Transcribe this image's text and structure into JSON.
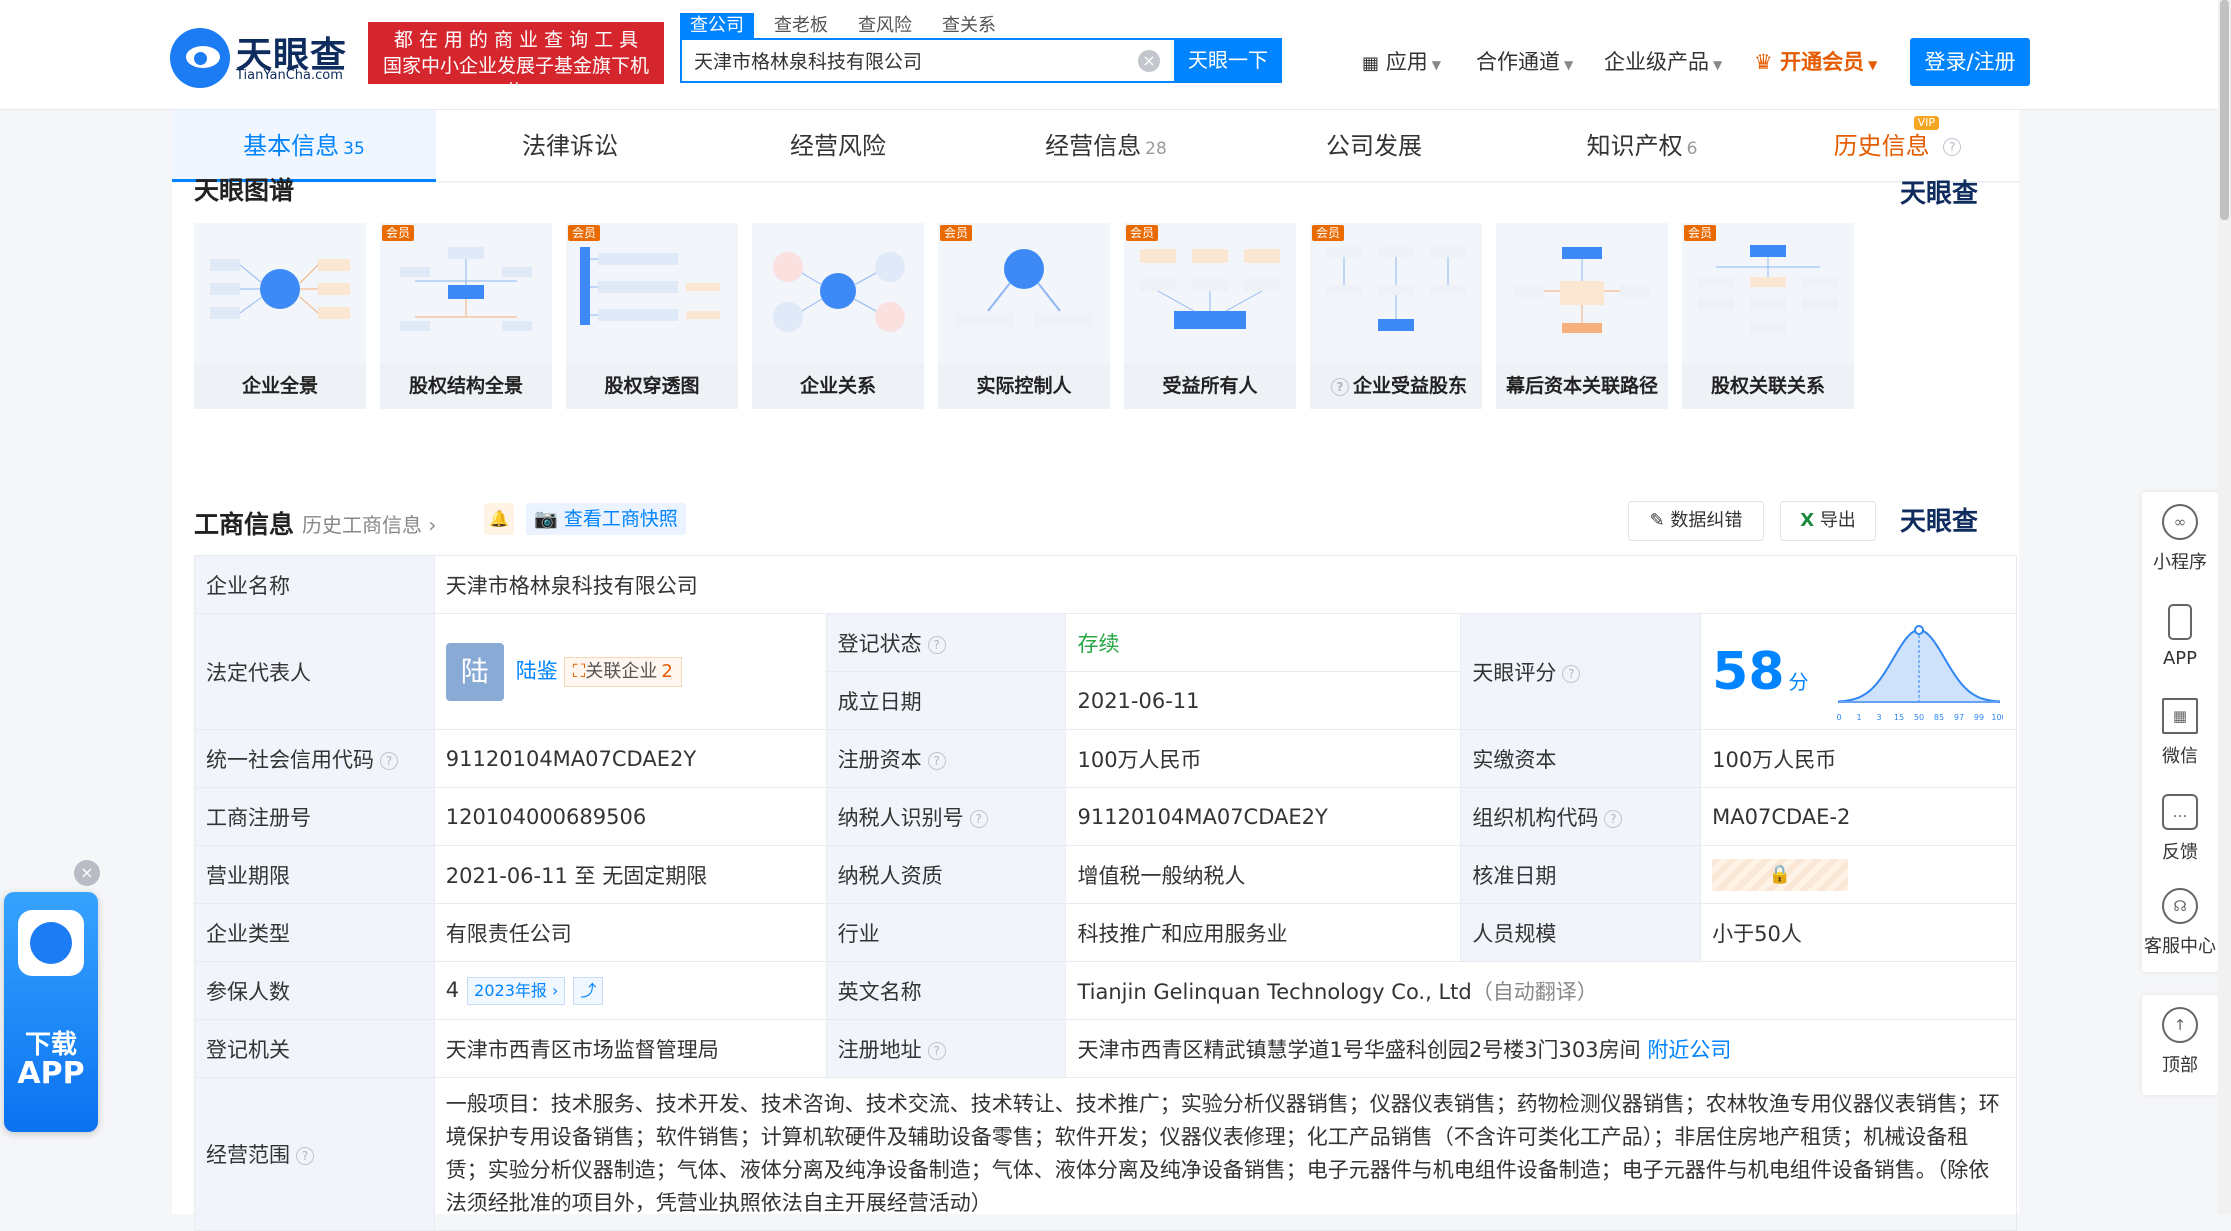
{
  "header": {
    "logo_text": "天眼查",
    "logo_sub": "TianYanCha.com",
    "slogan_line1": "都 在 用 的 商 业 查 询 工 具",
    "slogan_line2": "国家中小企业发展子基金旗下机构",
    "search_tabs": [
      "查公司",
      "查老板",
      "查风险",
      "查关系"
    ],
    "search_value": "天津市格林泉科技有限公司",
    "search_button": "天眼一下",
    "nav": [
      "应用",
      "合作通道",
      "企业级产品",
      "开通会员"
    ],
    "login": "登录/注册"
  },
  "tabs": [
    {
      "label": "基本信息",
      "count": "35"
    },
    {
      "label": "法律诉讼",
      "count": ""
    },
    {
      "label": "经营风险",
      "count": ""
    },
    {
      "label": "经营信息",
      "count": "28"
    },
    {
      "label": "公司发展",
      "count": ""
    },
    {
      "label": "知识产权",
      "count": "6"
    },
    {
      "label": "历史信息",
      "count": ""
    }
  ],
  "vip_badge": "VIP",
  "graph": {
    "title": "天眼图谱",
    "watermark": "天眼查",
    "member_badge": "会员",
    "cards": [
      "企业全景",
      "股权结构全景",
      "股权穿透图",
      "企业关系",
      "实际控制人",
      "受益所有人",
      "企业受益股东",
      "幕后资本关联路径",
      "股权关联关系"
    ]
  },
  "section": {
    "title": "工商信息",
    "history_link": "历史工商信息",
    "snapshot": "查看工商快照",
    "correct": "数据纠错",
    "export": "导出",
    "watermark": "天眼查"
  },
  "info": {
    "company_name_k": "企业名称",
    "company_name_v": "天津市格林泉科技有限公司",
    "legal_rep_k": "法定代表人",
    "legal_avatar": "陆",
    "legal_name": "陆鉴",
    "related_label": "关联企业",
    "related_count": "2",
    "status_k": "登记状态",
    "status_v": "存续",
    "found_k": "成立日期",
    "found_v": "2021-06-11",
    "score_k": "天眼评分",
    "score_v": "58",
    "score_unit": "分",
    "score_axis": [
      "0",
      "1",
      "3",
      "15",
      "50",
      "85",
      "97",
      "99",
      "100"
    ],
    "credit_k": "统一社会信用代码",
    "credit_v": "91120104MA07CDAE2Y",
    "capital_k": "注册资本",
    "capital_v": "100万人民币",
    "paid_k": "实缴资本",
    "paid_v": "100万人民币",
    "regno_k": "工商注册号",
    "regno_v": "120104000689506",
    "taxid_k": "纳税人识别号",
    "taxid_v": "91120104MA07CDAE2Y",
    "org_k": "组织机构代码",
    "org_v": "MA07CDAE-2",
    "term_k": "营业期限",
    "term_v": "2021-06-11 至 无固定期限",
    "taxq_k": "纳税人资质",
    "taxq_v": "增值税一般纳税人",
    "approve_k": "核准日期",
    "type_k": "企业类型",
    "type_v": "有限责任公司",
    "industry_k": "行业",
    "industry_v": "科技推广和应用服务业",
    "staff_k": "人员规模",
    "staff_v": "小于50人",
    "insured_k": "参保人数",
    "insured_v": "4",
    "insured_tag": "2023年报",
    "en_k": "英文名称",
    "en_v": "Tianjin Gelinquan Technology Co., Ltd",
    "en_note": "（自动翻译）",
    "reg_k": "登记机关",
    "reg_v": "天津市西青区市场监督管理局",
    "addr_k": "注册地址",
    "addr_v": "天津市西青区精武镇慧学道1号华盛科创园2号楼3门303房间",
    "addr_link": "附近公司",
    "scope_k": "经营范围",
    "scope_v": "一般项目：技术服务、技术开发、技术咨询、技术交流、技术转让、技术推广；实验分析仪器销售；仪器仪表销售；药物检测仪器销售；农林牧渔专用仪器仪表销售；环境保护专用设备销售；软件销售；计算机软硬件及辅助设备零售；软件开发；仪器仪表修理；化工产品销售（不含许可类化工产品）；非居住房地产租赁；机械设备租赁；实验分析仪器制造；气体、液体分离及纯净设备制造；气体、液体分离及纯净设备销售；电子元器件与机电组件设备制造；电子元器件与机电组件设备销售。（除依法须经批准的项目外，凭营业执照依法自主开展经营活动）"
  },
  "sidebar": [
    "小程序",
    "APP",
    "微信",
    "反馈",
    "客服中心",
    "顶部"
  ],
  "download": {
    "line1": "下载",
    "line2": "APP"
  }
}
